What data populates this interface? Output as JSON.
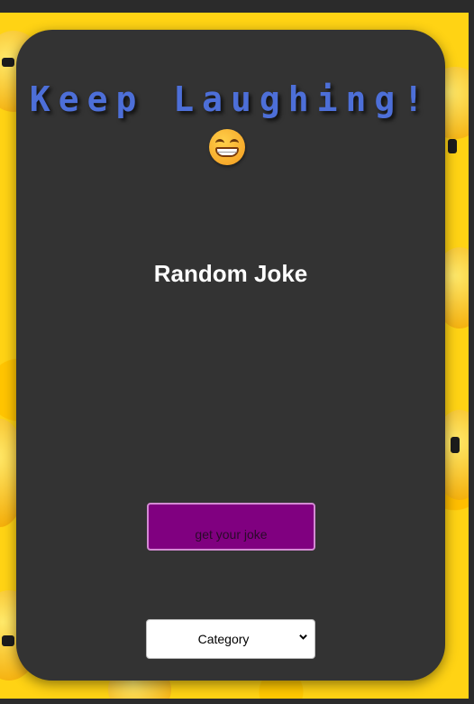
{
  "header": {
    "title": "Keep Laughing!",
    "emoji_icon": "grinning-face-icon"
  },
  "main": {
    "joke_heading": "Random Joke",
    "joke_button_label": "get your joke",
    "category_select": {
      "value": "Category",
      "icon": "chevron-down-icon"
    }
  },
  "colors": {
    "background": "#ffd314",
    "card": "#333333",
    "title": "#4d6fd8",
    "button": "#800080",
    "button_border": "#d38ad3"
  }
}
